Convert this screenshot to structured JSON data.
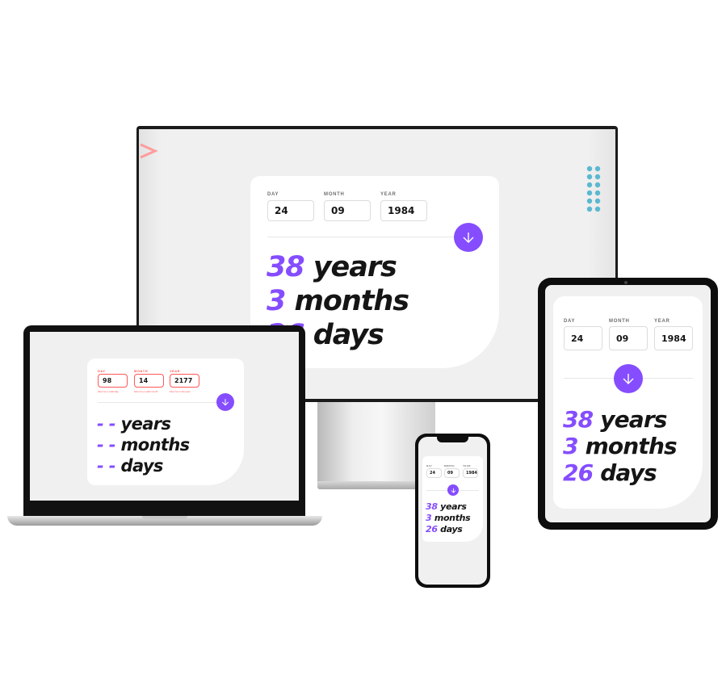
{
  "colors": {
    "accent": "#854dff",
    "text": "#151515",
    "error": "#ff5757",
    "label": "#716f6f",
    "screen": "#f0f0f0"
  },
  "desktop": {
    "day_label": "DAY",
    "month_label": "MONTH",
    "year_label": "YEAR",
    "day_value": "24",
    "month_value": "09",
    "year_value": "1984",
    "submit_icon": "arrow-down-icon",
    "years_num": "38",
    "years_word": "years",
    "months_num": "3",
    "months_word": "months",
    "days_num": "26",
    "days_word": "days"
  },
  "laptop": {
    "day_label": "DAY",
    "month_label": "MONTH",
    "year_label": "YEAR",
    "day_value": "98",
    "month_value": "14",
    "year_value": "2177",
    "day_error": "Must be a valid day",
    "month_error": "Must be a valid month",
    "year_error": "Must be in the past",
    "submit_icon": "arrow-down-icon",
    "years_num": "- -",
    "years_word": "years",
    "months_num": "- -",
    "months_word": "months",
    "days_num": "- -",
    "days_word": "days"
  },
  "tablet": {
    "day_label": "DAY",
    "month_label": "MONTH",
    "year_label": "YEAR",
    "day_value": "24",
    "month_value": "09",
    "year_value": "1984",
    "submit_icon": "arrow-down-icon",
    "years_num": "38",
    "years_word": "years",
    "months_num": "3",
    "months_word": "months",
    "days_num": "26",
    "days_word": "days"
  },
  "phone": {
    "day_label": "DAY",
    "month_label": "MONTH",
    "year_label": "YEAR",
    "day_value": "24",
    "month_value": "09",
    "year_value": "1984",
    "submit_icon": "arrow-down-icon",
    "years_num": "38",
    "years_word": "years",
    "months_num": "3",
    "months_word": "months",
    "days_num": "26",
    "days_word": "days"
  }
}
